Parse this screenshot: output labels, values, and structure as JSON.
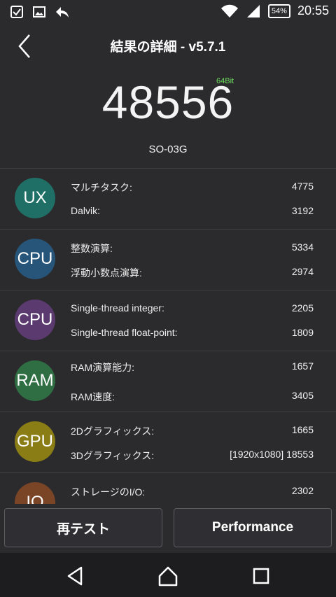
{
  "status_bar": {
    "battery": "54%",
    "time": "20:55"
  },
  "header": {
    "title": "結果の詳細 - v5.7.1"
  },
  "score": {
    "arch": "64Bit",
    "value": "48556",
    "device": "SO-03G"
  },
  "categories": [
    {
      "badge": "UX",
      "color": "#1f6f66",
      "items": [
        {
          "label": "マルチタスク:",
          "value": "4775"
        },
        {
          "label": "Dalvik:",
          "value": "3192"
        }
      ]
    },
    {
      "badge": "CPU",
      "color": "#27557a",
      "items": [
        {
          "label": "整数演算:",
          "value": "5334"
        },
        {
          "label": "浮動小数点演算:",
          "value": "2974"
        }
      ]
    },
    {
      "badge": "CPU",
      "color": "#5a3a6f",
      "items": [
        {
          "label": "Single-thread integer:",
          "value": "2205"
        },
        {
          "label": "Single-thread float-point:",
          "value": "1809"
        }
      ]
    },
    {
      "badge": "RAM",
      "color": "#2f6d43",
      "items": [
        {
          "label": "RAM演算能力:",
          "value": "1657"
        },
        {
          "label": "RAM速度:",
          "value": "3405"
        }
      ]
    },
    {
      "badge": "GPU",
      "color": "#8a7d16",
      "items": [
        {
          "label": "2Dグラフィックス:",
          "value": "1665"
        },
        {
          "label": "3Dグラフィックス:",
          "value": "[1920x1080] 18553"
        }
      ]
    },
    {
      "badge": "IO",
      "color": "#7a4526",
      "items": [
        {
          "label": "ストレージのI/O:",
          "value": "2302"
        }
      ]
    }
  ],
  "buttons": {
    "retest": "再テスト",
    "performance": "Performance"
  },
  "icons": {
    "status_left": [
      "checkbox-icon",
      "image-icon",
      "reply-icon"
    ],
    "status_right": [
      "wifi-icon",
      "signal-icon",
      "battery-icon"
    ],
    "nav": [
      "back-triangle-icon",
      "home-icon",
      "recents-icon"
    ]
  }
}
